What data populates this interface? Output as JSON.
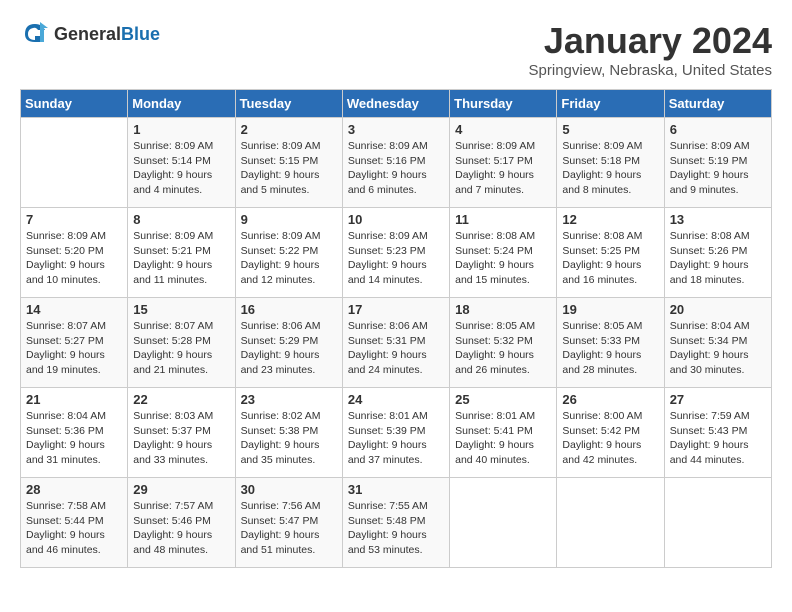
{
  "header": {
    "logo_general": "General",
    "logo_blue": "Blue",
    "month": "January 2024",
    "location": "Springview, Nebraska, United States"
  },
  "days_of_week": [
    "Sunday",
    "Monday",
    "Tuesday",
    "Wednesday",
    "Thursday",
    "Friday",
    "Saturday"
  ],
  "weeks": [
    [
      {
        "day": "",
        "info": ""
      },
      {
        "day": "1",
        "info": "Sunrise: 8:09 AM\nSunset: 5:14 PM\nDaylight: 9 hours\nand 4 minutes."
      },
      {
        "day": "2",
        "info": "Sunrise: 8:09 AM\nSunset: 5:15 PM\nDaylight: 9 hours\nand 5 minutes."
      },
      {
        "day": "3",
        "info": "Sunrise: 8:09 AM\nSunset: 5:16 PM\nDaylight: 9 hours\nand 6 minutes."
      },
      {
        "day": "4",
        "info": "Sunrise: 8:09 AM\nSunset: 5:17 PM\nDaylight: 9 hours\nand 7 minutes."
      },
      {
        "day": "5",
        "info": "Sunrise: 8:09 AM\nSunset: 5:18 PM\nDaylight: 9 hours\nand 8 minutes."
      },
      {
        "day": "6",
        "info": "Sunrise: 8:09 AM\nSunset: 5:19 PM\nDaylight: 9 hours\nand 9 minutes."
      }
    ],
    [
      {
        "day": "7",
        "info": "Sunrise: 8:09 AM\nSunset: 5:20 PM\nDaylight: 9 hours\nand 10 minutes."
      },
      {
        "day": "8",
        "info": "Sunrise: 8:09 AM\nSunset: 5:21 PM\nDaylight: 9 hours\nand 11 minutes."
      },
      {
        "day": "9",
        "info": "Sunrise: 8:09 AM\nSunset: 5:22 PM\nDaylight: 9 hours\nand 12 minutes."
      },
      {
        "day": "10",
        "info": "Sunrise: 8:09 AM\nSunset: 5:23 PM\nDaylight: 9 hours\nand 14 minutes."
      },
      {
        "day": "11",
        "info": "Sunrise: 8:08 AM\nSunset: 5:24 PM\nDaylight: 9 hours\nand 15 minutes."
      },
      {
        "day": "12",
        "info": "Sunrise: 8:08 AM\nSunset: 5:25 PM\nDaylight: 9 hours\nand 16 minutes."
      },
      {
        "day": "13",
        "info": "Sunrise: 8:08 AM\nSunset: 5:26 PM\nDaylight: 9 hours\nand 18 minutes."
      }
    ],
    [
      {
        "day": "14",
        "info": "Sunrise: 8:07 AM\nSunset: 5:27 PM\nDaylight: 9 hours\nand 19 minutes."
      },
      {
        "day": "15",
        "info": "Sunrise: 8:07 AM\nSunset: 5:28 PM\nDaylight: 9 hours\nand 21 minutes."
      },
      {
        "day": "16",
        "info": "Sunrise: 8:06 AM\nSunset: 5:29 PM\nDaylight: 9 hours\nand 23 minutes."
      },
      {
        "day": "17",
        "info": "Sunrise: 8:06 AM\nSunset: 5:31 PM\nDaylight: 9 hours\nand 24 minutes."
      },
      {
        "day": "18",
        "info": "Sunrise: 8:05 AM\nSunset: 5:32 PM\nDaylight: 9 hours\nand 26 minutes."
      },
      {
        "day": "19",
        "info": "Sunrise: 8:05 AM\nSunset: 5:33 PM\nDaylight: 9 hours\nand 28 minutes."
      },
      {
        "day": "20",
        "info": "Sunrise: 8:04 AM\nSunset: 5:34 PM\nDaylight: 9 hours\nand 30 minutes."
      }
    ],
    [
      {
        "day": "21",
        "info": "Sunrise: 8:04 AM\nSunset: 5:36 PM\nDaylight: 9 hours\nand 31 minutes."
      },
      {
        "day": "22",
        "info": "Sunrise: 8:03 AM\nSunset: 5:37 PM\nDaylight: 9 hours\nand 33 minutes."
      },
      {
        "day": "23",
        "info": "Sunrise: 8:02 AM\nSunset: 5:38 PM\nDaylight: 9 hours\nand 35 minutes."
      },
      {
        "day": "24",
        "info": "Sunrise: 8:01 AM\nSunset: 5:39 PM\nDaylight: 9 hours\nand 37 minutes."
      },
      {
        "day": "25",
        "info": "Sunrise: 8:01 AM\nSunset: 5:41 PM\nDaylight: 9 hours\nand 40 minutes."
      },
      {
        "day": "26",
        "info": "Sunrise: 8:00 AM\nSunset: 5:42 PM\nDaylight: 9 hours\nand 42 minutes."
      },
      {
        "day": "27",
        "info": "Sunrise: 7:59 AM\nSunset: 5:43 PM\nDaylight: 9 hours\nand 44 minutes."
      }
    ],
    [
      {
        "day": "28",
        "info": "Sunrise: 7:58 AM\nSunset: 5:44 PM\nDaylight: 9 hours\nand 46 minutes."
      },
      {
        "day": "29",
        "info": "Sunrise: 7:57 AM\nSunset: 5:46 PM\nDaylight: 9 hours\nand 48 minutes."
      },
      {
        "day": "30",
        "info": "Sunrise: 7:56 AM\nSunset: 5:47 PM\nDaylight: 9 hours\nand 51 minutes."
      },
      {
        "day": "31",
        "info": "Sunrise: 7:55 AM\nSunset: 5:48 PM\nDaylight: 9 hours\nand 53 minutes."
      },
      {
        "day": "",
        "info": ""
      },
      {
        "day": "",
        "info": ""
      },
      {
        "day": "",
        "info": ""
      }
    ]
  ]
}
